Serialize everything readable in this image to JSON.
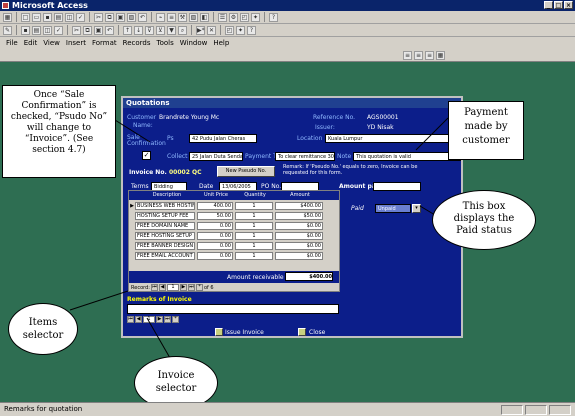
{
  "window": {
    "title": "Microsoft Access",
    "controls": [
      "_",
      "□",
      "×"
    ]
  },
  "menu": [
    "File",
    "Edit",
    "View",
    "Insert",
    "Format",
    "Records",
    "Tools",
    "Window",
    "Help"
  ],
  "status": {
    "text": "Remarks for quotation"
  },
  "form": {
    "title": "Quotations",
    "customer_label": "Customer",
    "customer_value": "Brandrete Young Mc",
    "name_label": "Name:",
    "reference_label": "Reference No.",
    "reference_value": "AGS00001",
    "issuer_label": "Issuer:",
    "issuer_value": "YD Nisak",
    "sale_conf_label": "Sale Confirmation",
    "ps_label": "Ps",
    "address_value": "42 Pudu Jalan Cheras",
    "location_label": "Location",
    "location_value": "Kuala Lumpur",
    "collect_label": "Collect",
    "collect_value": "25 Jalan Duta Sendana",
    "payment_term_label": "Payment Term",
    "payment_term_value": "To clear remittance 30 days",
    "note_label": "Note",
    "note_value": "This quotation is valid",
    "invoice_label": "Invoice No.",
    "invoice_value": "00002 QC",
    "new_pseudo_button": "New Pseudo No.",
    "pseudo_note": "Remark: If 'Pseudo No.' equals to zero, Invoice can be requested for this form.",
    "terms_label": "Terms",
    "terms_value": "Bidding",
    "date_label": "Date",
    "date_value": "13/06/2005",
    "po_label": "PO No.",
    "amount_paid_label": "Amount paid",
    "paid_label": "Paid",
    "paid_status": "Unpaid",
    "items_header": [
      "Description",
      "Unit Price",
      "Quantity",
      "Amount"
    ],
    "items": [
      [
        "BUSINESS WEB HOSTING",
        "400.00",
        "1",
        "$400.00"
      ],
      [
        "HOSTING SETUP FEE",
        "50.00",
        "1",
        "$50.00"
      ],
      [
        "FREE DOMAIN NAME",
        "0.00",
        "1",
        "$0.00"
      ],
      [
        "FREE HOSTING SETUP",
        "0.00",
        "1",
        "$0.00"
      ],
      [
        "FREE BANNER DESIGN",
        "0.00",
        "1",
        "$0.00"
      ],
      [
        "FREE EMAIL ACCOUNT",
        "0.00",
        "1",
        "$0.00"
      ]
    ],
    "amount_receivable_label": "Amount receivable",
    "amount_receivable_value": "$400.00",
    "record_label": "Record:",
    "record_index": "1",
    "record_of": "of 6",
    "remarks_label": "Remarks of Invoice",
    "issue_invoice_button": "Issue Invoice",
    "close_button": "Close",
    "bottom_record_index": "1"
  },
  "callouts": {
    "sale_confirmation": "Once “Sale Confirmation” is checked, “Psudo No” will change to “Invoice”. (See section 4.7)",
    "payment": "Payment made by customer",
    "paid_status": "This box displays the Paid status",
    "items_selector": "Items selector",
    "invoice_selector": "Invoice selector"
  }
}
